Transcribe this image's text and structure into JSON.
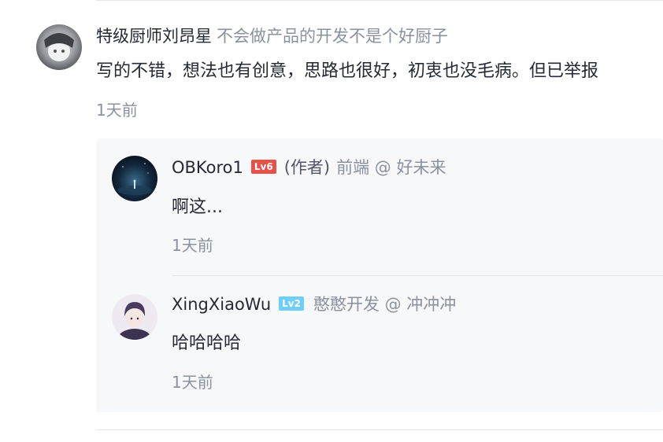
{
  "comment": {
    "username": "特级厨师刘昂星",
    "description": "不会做产品的开发不是个好厨子",
    "content": "写的不错，想法也有创意，思路也很好，初衷也没毛病。但已举报",
    "time": "1天前"
  },
  "replies": [
    {
      "username": "OBKoro1",
      "level": "Lv6",
      "level_color": "#e8504a",
      "author_tag": "(作者)",
      "description": "前端 @ 好未来",
      "content": "啊这...",
      "time": "1天前"
    },
    {
      "username": "XingXiaoWu",
      "level": "Lv2",
      "level_color": "#6ecfff",
      "description": "憨憨开发 @ 冲冲冲",
      "content": "哈哈哈哈",
      "time": "1天前"
    }
  ]
}
